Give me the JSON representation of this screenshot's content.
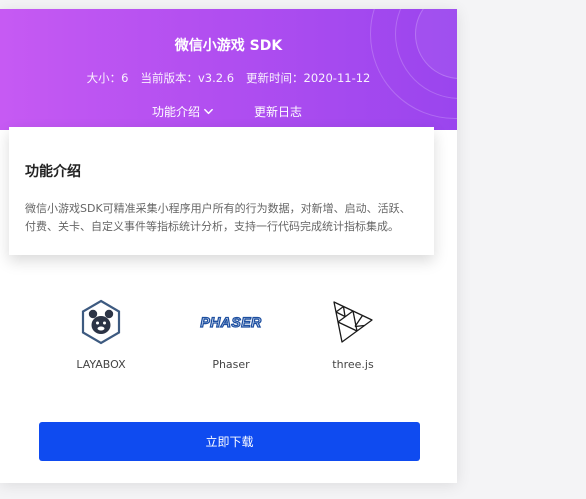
{
  "header": {
    "title": "微信小游戏 SDK",
    "size": "大小：6",
    "version": "当前版本：v3.2.6",
    "updated": "更新时间：2020-11-12",
    "tabs": [
      {
        "label": "功能介绍"
      },
      {
        "label": "更新日志"
      }
    ]
  },
  "popup": {
    "title": "功能介绍",
    "description": "微信小游戏SDK可精准采集小程序用户所有的行为数据，对新增、启动、活跃、付费、关卡、自定义事件等指标统计分析，支持一行代码完成统计指标集成。"
  },
  "engines": [
    {
      "name": "LAYABOX",
      "icon": "layabox-logo-icon"
    },
    {
      "name": "Phaser",
      "icon": "phaser-logo-icon",
      "logo_text": "PHASER"
    },
    {
      "name": "three.js",
      "icon": "threejs-logo-icon"
    }
  ],
  "download_label": "立即下载",
  "colors": {
    "header_start": "#c65af3",
    "header_end": "#9a45ee",
    "button": "#0f4bf0"
  }
}
